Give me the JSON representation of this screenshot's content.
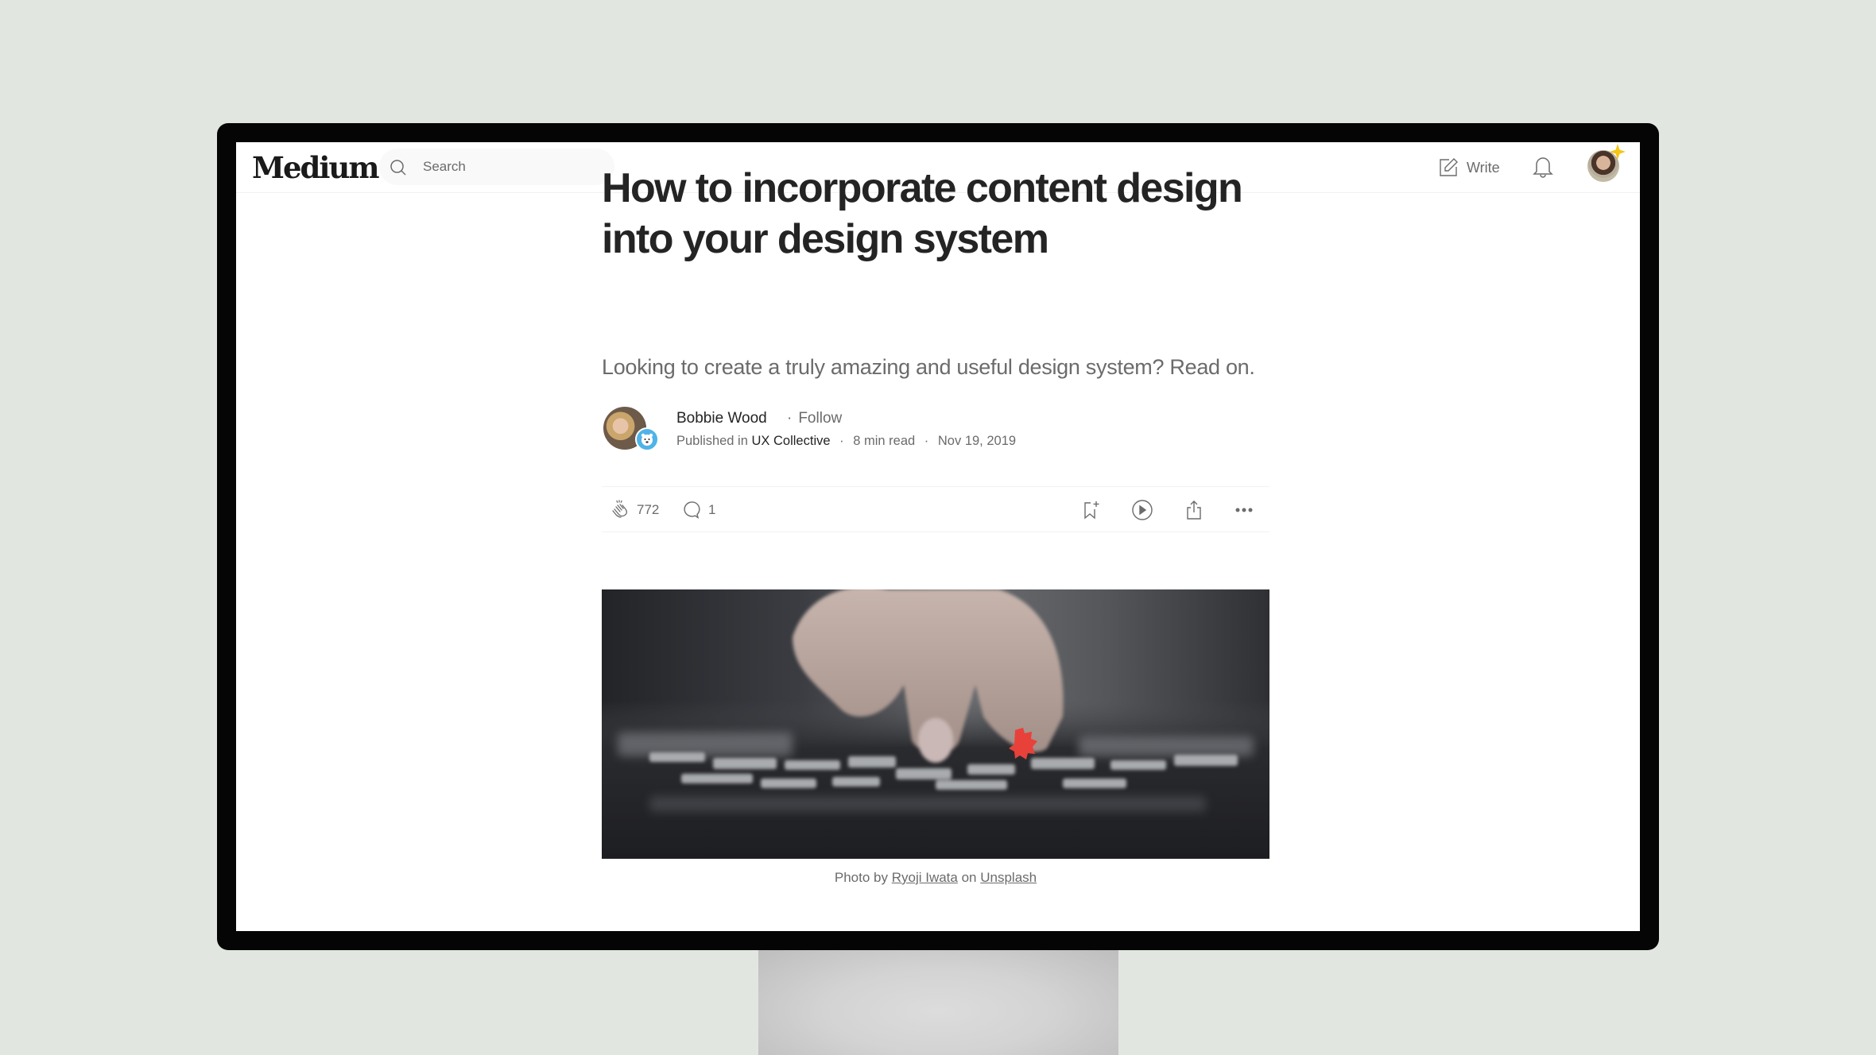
{
  "header": {
    "logo": "Medium",
    "search": {
      "placeholder": "Search",
      "icon": "search-icon"
    },
    "write_label": "Write",
    "write_icon": "write-icon",
    "notifications_icon": "bell-icon",
    "user_avatar_icon": "user-avatar"
  },
  "article": {
    "title": "How to incorporate content design into your design system",
    "subtitle": "Looking to create a truly amazing and useful design system? Read on.",
    "author": {
      "name": "Bobbie Wood",
      "follow_label": "Follow",
      "published_in_prefix": "Published in",
      "publication": "UX Collective",
      "read_time": "8 min read",
      "date": "Nov 19, 2019"
    },
    "actions": {
      "claps": "772",
      "comments": "1",
      "icons": [
        "clap-icon",
        "comment-icon",
        "bookmark-add-icon",
        "play-icon",
        "share-icon",
        "more-icon"
      ]
    },
    "image": {
      "alt": "Hand placing a red puzzle piece among grey puzzle pieces",
      "caption_prefix": "Photo by",
      "photographer": "Ryoji Iwata",
      "caption_mid": "on",
      "source": "Unsplash"
    }
  },
  "colors": {
    "background": "#e1e6e0",
    "text_primary": "#242424",
    "text_secondary": "#6b6b6b",
    "accent_puzzle": "#e8413a",
    "sparkle": "#f5c518",
    "publication_badge": "#4fb3e8"
  }
}
